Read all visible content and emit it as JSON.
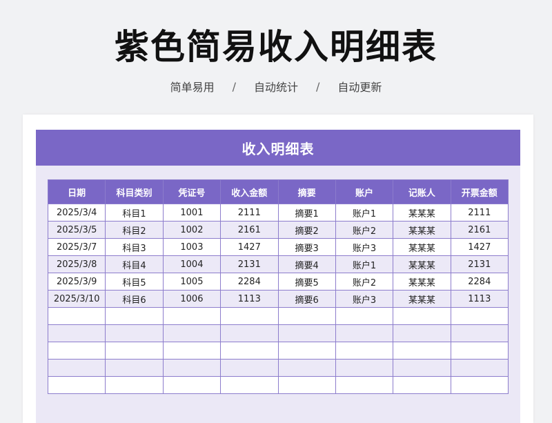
{
  "header": {
    "title": "紫色简易收入明细表",
    "tags": [
      "简单易用",
      "自动统计",
      "自动更新"
    ],
    "separator": "/"
  },
  "sheet": {
    "banner_title": "收入明细表",
    "columns": [
      "日期",
      "科目类别",
      "凭证号",
      "收入金额",
      "摘要",
      "账户",
      "记账人",
      "开票金额"
    ],
    "rows": [
      [
        "2025/3/4",
        "科目1",
        "1001",
        "2111",
        "摘要1",
        "账户1",
        "某某某",
        "2111"
      ],
      [
        "2025/3/5",
        "科目2",
        "1002",
        "2161",
        "摘要2",
        "账户2",
        "某某某",
        "2161"
      ],
      [
        "2025/3/7",
        "科目3",
        "1003",
        "1427",
        "摘要3",
        "账户3",
        "某某某",
        "1427"
      ],
      [
        "2025/3/8",
        "科目4",
        "1004",
        "2131",
        "摘要4",
        "账户1",
        "某某某",
        "2131"
      ],
      [
        "2025/3/9",
        "科目5",
        "1005",
        "2284",
        "摘要5",
        "账户2",
        "某某某",
        "2284"
      ],
      [
        "2025/3/10",
        "科目6",
        "1006",
        "1113",
        "摘要6",
        "账户3",
        "某某某",
        "1113"
      ],
      [
        "",
        "",
        "",
        "",
        "",
        "",
        "",
        ""
      ],
      [
        "",
        "",
        "",
        "",
        "",
        "",
        "",
        ""
      ],
      [
        "",
        "",
        "",
        "",
        "",
        "",
        "",
        ""
      ],
      [
        "",
        "",
        "",
        "",
        "",
        "",
        "",
        ""
      ],
      [
        "",
        "",
        "",
        "",
        "",
        "",
        "",
        ""
      ]
    ]
  },
  "colors": {
    "accent": "#7a67c6",
    "stripe": "#ece9f7",
    "panel": "#ebe8f6",
    "background": "#f1f2f4"
  }
}
